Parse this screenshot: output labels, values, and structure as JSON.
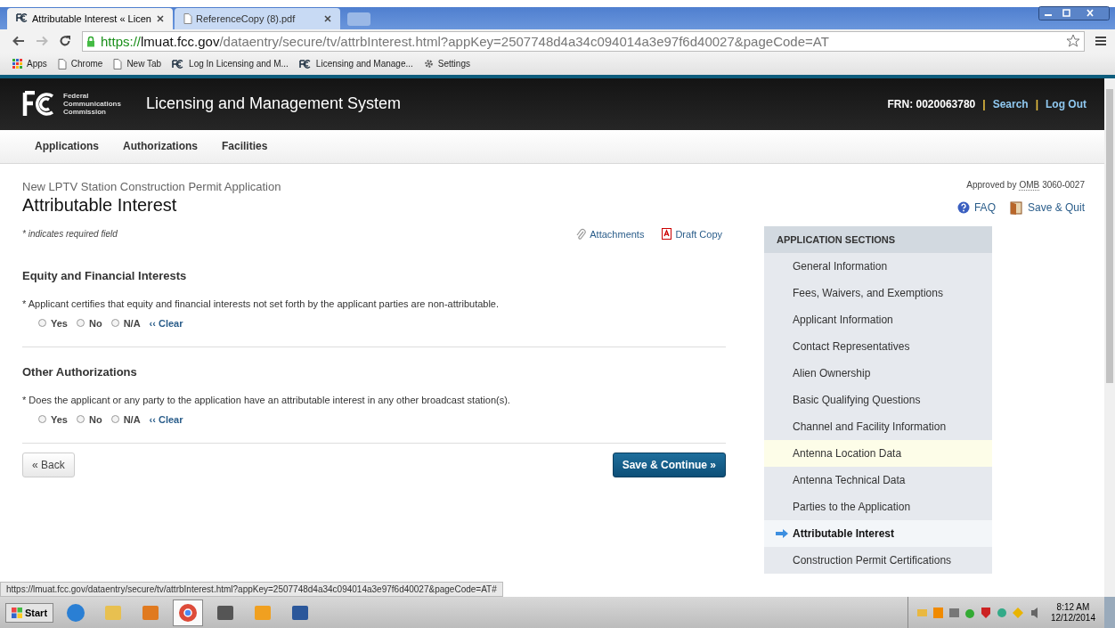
{
  "browser": {
    "tabs": [
      {
        "title": "Attributable Interest « Licen",
        "selected": true,
        "kind": "fcc"
      },
      {
        "title": "ReferenceCopy (8).pdf",
        "selected": false,
        "kind": "doc"
      }
    ],
    "address": {
      "scheme": "https://",
      "host": "lmuat.fcc.gov",
      "path": "/dataentry/secure/tv/attrbInterest.html?appKey=2507748d4a34c094014a3e97f6d40027&pageCode=AT"
    },
    "bookmarks": [
      {
        "label": "Apps",
        "kind": "apps"
      },
      {
        "label": "Chrome",
        "kind": "page"
      },
      {
        "label": "New Tab",
        "kind": "page"
      },
      {
        "label": "Log In Licensing and M...",
        "kind": "fcc"
      },
      {
        "label": "Licensing and Manage...",
        "kind": "fcc"
      },
      {
        "label": "Settings",
        "kind": "gear"
      }
    ],
    "status_url": "https://lmuat.fcc.gov/dataentry/secure/tv/attrbInterest.html?appKey=2507748d4a34c094014a3e97f6d40027&pageCode=AT#"
  },
  "header": {
    "agency": [
      "Federal",
      "Communications",
      "Commission"
    ],
    "system": "Licensing and Management System",
    "frn": "FRN: 0020063780",
    "separator": "|",
    "links": [
      "Search",
      "Log Out"
    ]
  },
  "nav": [
    "Applications",
    "Authorizations",
    "Facilities"
  ],
  "page": {
    "subtitle": "New LPTV Station Construction Permit Application",
    "title": "Attributable Interest",
    "approved": "Approved by",
    "omb": "OMB",
    "omb_number": "3060-0027",
    "faq": "FAQ",
    "save_quit": "Save & Quit",
    "required_note": "* indicates required field",
    "attachments": "Attachments",
    "draft_copy": "Draft Copy"
  },
  "sections": [
    {
      "heading": "Equity and Financial Interests",
      "question": "* Applicant certifies that equity and financial interests not set forth by the applicant parties are non-attributable.",
      "options": [
        {
          "label": "Yes",
          "selected": false
        },
        {
          "label": "No",
          "selected": false
        },
        {
          "label": "N/A",
          "selected": false
        }
      ],
      "clear": "‹‹ Clear"
    },
    {
      "heading": "Other Authorizations",
      "question": "* Does the applicant or any party to the application have an attributable interest in any other broadcast station(s).",
      "options": [
        {
          "label": "Yes",
          "selected": false
        },
        {
          "label": "No",
          "selected": false
        },
        {
          "label": "N/A",
          "selected": false
        }
      ],
      "clear": "‹‹ Clear"
    }
  ],
  "buttons": {
    "back": "« Back",
    "continue": "Save & Continue »"
  },
  "sidebar": {
    "heading": "APPLICATION SECTIONS",
    "items": [
      {
        "label": "General Information",
        "selected": false,
        "highlighted": false
      },
      {
        "label": "Fees, Waivers, and Exemptions",
        "selected": false,
        "highlighted": false
      },
      {
        "label": "Applicant Information",
        "selected": false,
        "highlighted": false
      },
      {
        "label": "Contact Representatives",
        "selected": false,
        "highlighted": false
      },
      {
        "label": "Alien Ownership",
        "selected": false,
        "highlighted": false
      },
      {
        "label": "Basic Qualifying Questions",
        "selected": false,
        "highlighted": false
      },
      {
        "label": "Channel and Facility Information",
        "selected": false,
        "highlighted": false
      },
      {
        "label": "Antenna Location Data",
        "selected": false,
        "highlighted": true
      },
      {
        "label": "Antenna Technical Data",
        "selected": false,
        "highlighted": false
      },
      {
        "label": "Parties to the Application",
        "selected": false,
        "highlighted": false
      },
      {
        "label": "Attributable Interest",
        "selected": true,
        "highlighted": false
      },
      {
        "label": "Construction Permit Certifications",
        "selected": false,
        "highlighted": false
      }
    ]
  },
  "taskbar": {
    "start": "Start",
    "apps": [
      {
        "kind": "ie",
        "selected": false
      },
      {
        "kind": "folder",
        "selected": false
      },
      {
        "kind": "media",
        "selected": false
      },
      {
        "kind": "chrome",
        "selected": true
      },
      {
        "kind": "phone",
        "selected": false
      },
      {
        "kind": "outlook",
        "selected": false
      },
      {
        "kind": "word",
        "selected": false
      }
    ],
    "time": "8:12 AM",
    "date": "12/12/2014"
  }
}
